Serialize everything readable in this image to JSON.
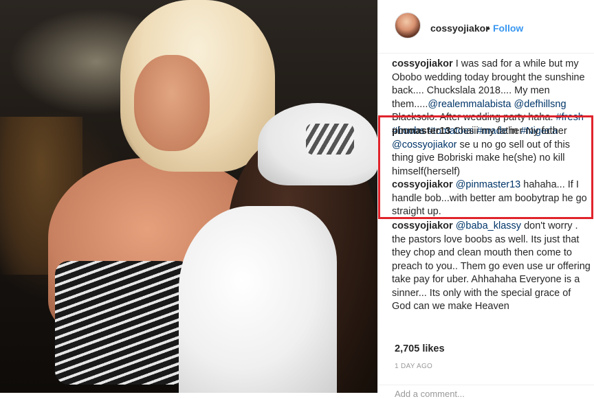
{
  "post": {
    "username": "cossyojiakor",
    "dot": "•",
    "follow_label": "Follow",
    "caption": {
      "username": "cossyojiakor",
      "text_1": "I was sad for a while but my Obobo wedding today brought the sunshine back.... Chuckslala 2018.... My men them.....",
      "mention_1": "@realemmalabista",
      "mention_2": "@defhillsng",
      "text_2": "Blacksolo. After wedding party haha.",
      "tag_1": "#fresh",
      "tag_2": "#boobs",
      "tag_3": "#tomatoes",
      "tag_4": "#made",
      "text_3": "in",
      "tag_5": "#Nigeria"
    },
    "comments": [
      {
        "username": "pinmaster13",
        "text_1": "Chaiii my father my father",
        "mention": "@cossyojiakor",
        "text_2": "se u no go sell out of this thing give Bobriski make he(she) no kill himself(herself)"
      },
      {
        "username": "cossyojiakor",
        "mention": "@pinmaster13",
        "text_2": "hahaha... If I handle bob...with better am boobytrap he go straight up."
      },
      {
        "username": "cossyojiakor",
        "mention": "@baba_klassy",
        "text_2": "don't worry . the pastors love boobs as well. Its just that they chop and clean mouth then come to preach to you.. Them go even use ur offering take pay for uber. Ahhahaha Everyone is a sinner... Its only with the special grace of God can we make Heaven"
      }
    ],
    "likes": "2,705 likes",
    "time": "1 DAY AGO",
    "add_comment_placeholder": "Add a comment..."
  },
  "colors": {
    "link": "#003569",
    "follow": "#3897f0",
    "highlight_box": "#e0232b"
  }
}
